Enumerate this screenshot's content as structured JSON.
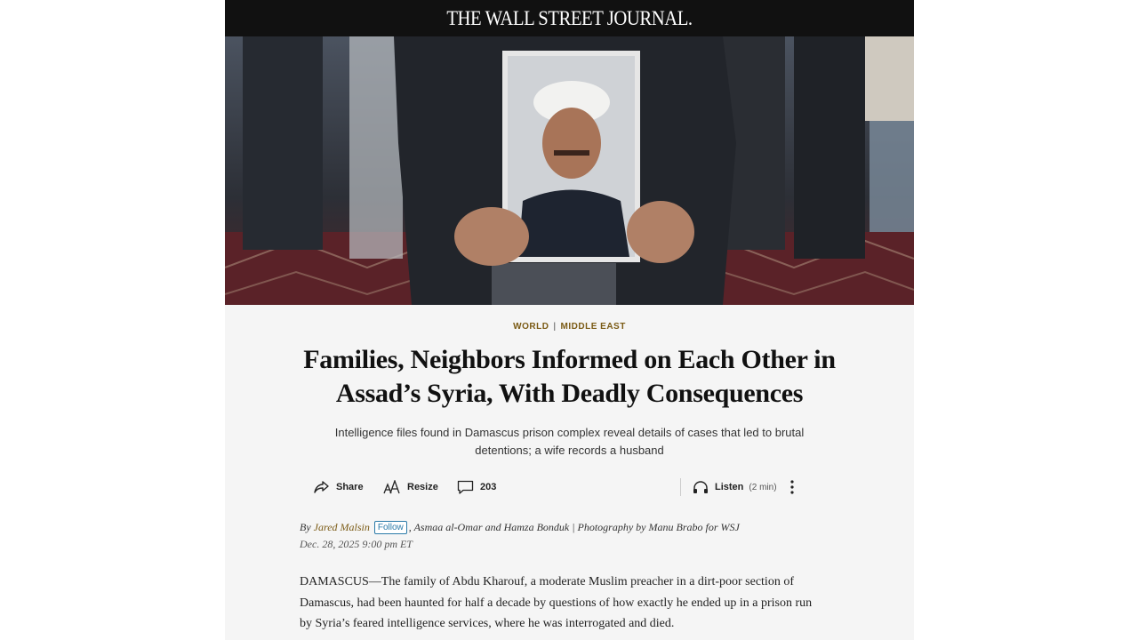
{
  "masthead": {
    "logo_text": "THE WALL STREET JOURNAL."
  },
  "hero": {
    "description_icon": "photo"
  },
  "sections": {
    "primary": "WORLD",
    "separator": "|",
    "secondary": "MIDDLE EAST"
  },
  "article": {
    "headline": "Families, Neighbors Informed on Each Other in Assad’s Syria, With Deadly Consequences",
    "dek": "Intelligence files found in Damascus prison complex reveal details of cases that led to brutal detentions; a wife records a husband",
    "byline": {
      "prefix": "By",
      "author": "Jared Malsin",
      "follow_label": "Follow",
      "rest": ", Asmaa al-Omar and Hamza Bonduk | Photography by Manu Brabo for WSJ"
    },
    "date": "Dec. 28, 2025 9:00 pm ET",
    "body": "DAMASCUS—The family of Abdu Kharouf, a moderate Muslim preacher in a dirt-poor section of Damascus, had been haunted for half a decade by questions of how exactly he ended up in a prison run by Syria’s feared intelligence services, where he was interrogated and died."
  },
  "toolbar": {
    "share_label": "Share",
    "resize_label": "Resize",
    "comments_count": "203",
    "listen_label": "Listen",
    "listen_duration": "(2 min)"
  },
  "colors": {
    "accent": "#7a5a14",
    "follow": "#2a7aa8",
    "masthead_bg": "#111111"
  }
}
